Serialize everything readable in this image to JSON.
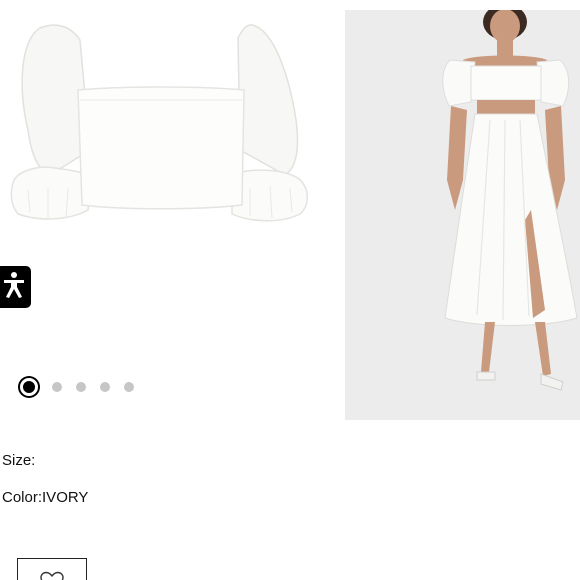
{
  "product": {
    "size_label": "Size:",
    "color_label": "Color:",
    "color_value": "IVORY"
  },
  "gallery": {
    "slides": 5,
    "active_index": 0,
    "main_image_alt": "white puff sleeve crop top",
    "side_image_alt": "model wearing white crop top and midi skirt"
  },
  "icons": {
    "accessibility": "accessibility-icon",
    "favorite": "heart-icon"
  },
  "colors": {
    "accent": "#000000",
    "dot_inactive": "#c6c6c6",
    "image_bg": "#ececec"
  }
}
